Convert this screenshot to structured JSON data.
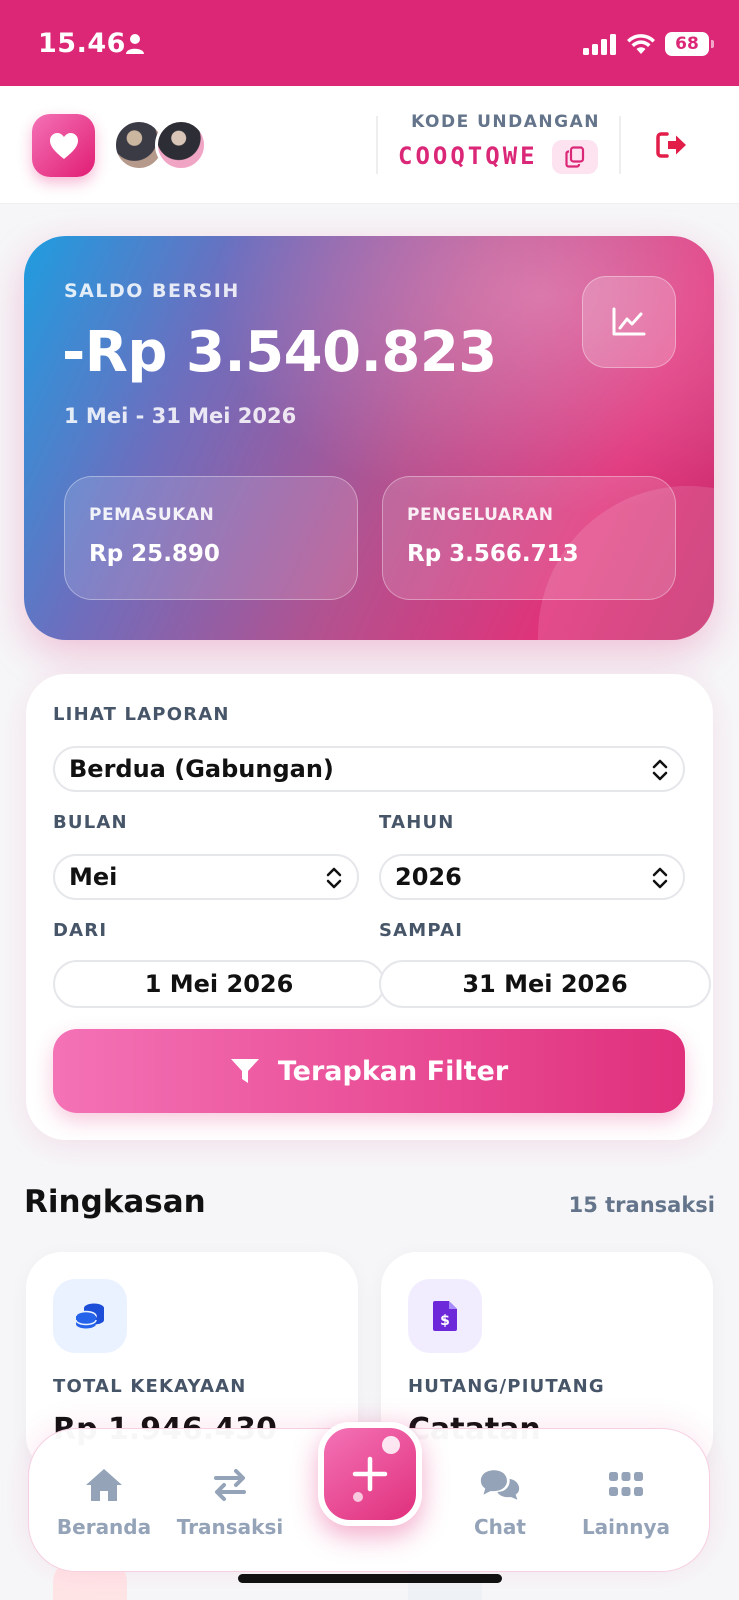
{
  "status_bar": {
    "time": "15.46",
    "battery": "68"
  },
  "header": {
    "invite_label": "KODE UNDANGAN",
    "invite_code": "COOQTQWE",
    "icons": [
      "heart-icon",
      "copy-icon",
      "logout-icon"
    ]
  },
  "balance": {
    "label": "SALDO BERSIH",
    "amount": "-Rp 3.540.823",
    "period": "1 Mei - 31 Mei 2026",
    "income_label": "PEMASUKAN",
    "income_value": "Rp 25.890",
    "expense_label": "PENGELUARAN",
    "expense_value": "Rp 3.566.713"
  },
  "filter": {
    "report_label": "LIHAT LAPORAN",
    "report_value": "Berdua (Gabungan)",
    "month_label": "BULAN",
    "month_value": "Mei",
    "year_label": "TAHUN",
    "year_value": "2026",
    "from_label": "DARI",
    "from_value": "1 Mei 2026",
    "to_label": "SAMPAI",
    "to_value": "31 Mei 2026",
    "apply_label": "Terapkan Filter"
  },
  "summary": {
    "title": "Ringkasan",
    "count": "15 transaksi",
    "cards": [
      {
        "label": "TOTAL KEKAYAAN",
        "value": "Rp 1.946.430"
      },
      {
        "label": "HUTANG/PIUTANG",
        "value": "Catatan"
      }
    ]
  },
  "nav": {
    "items": [
      {
        "label": "Beranda",
        "icon": "home-icon"
      },
      {
        "label": "Transaksi",
        "icon": "swap-icon"
      },
      {
        "label": "Chat",
        "icon": "chat-icon"
      },
      {
        "label": "Lainnya",
        "icon": "grid-icon"
      }
    ]
  },
  "colors": {
    "brand": "#dc2777",
    "accent_light": "#fde2ef",
    "muted": "#64748b"
  }
}
